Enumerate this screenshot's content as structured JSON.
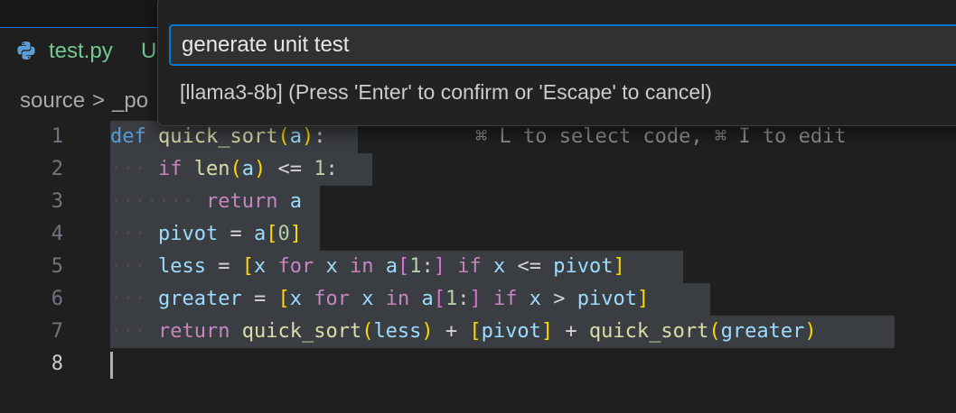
{
  "tab": {
    "filename": "test.py",
    "badge": "U"
  },
  "breadcrumb": {
    "part1": "source",
    "sep": ">",
    "part2": "_po"
  },
  "palette": {
    "input_value": "generate unit test",
    "message": "[llama3-8b] (Press 'Enter' to confirm or 'Escape' to cancel)"
  },
  "editor": {
    "line_numbers": [
      "1",
      "2",
      "3",
      "4",
      "5",
      "6",
      "7",
      "8"
    ],
    "hint": "⌘ L to select code, ⌘ I to edit"
  },
  "colors": {
    "accent": "#0078d4",
    "keyword": "#569cd6",
    "function": "#dcdcaa",
    "control": "#c586c0",
    "variable": "#9cdcfe",
    "number": "#b5cea8"
  }
}
